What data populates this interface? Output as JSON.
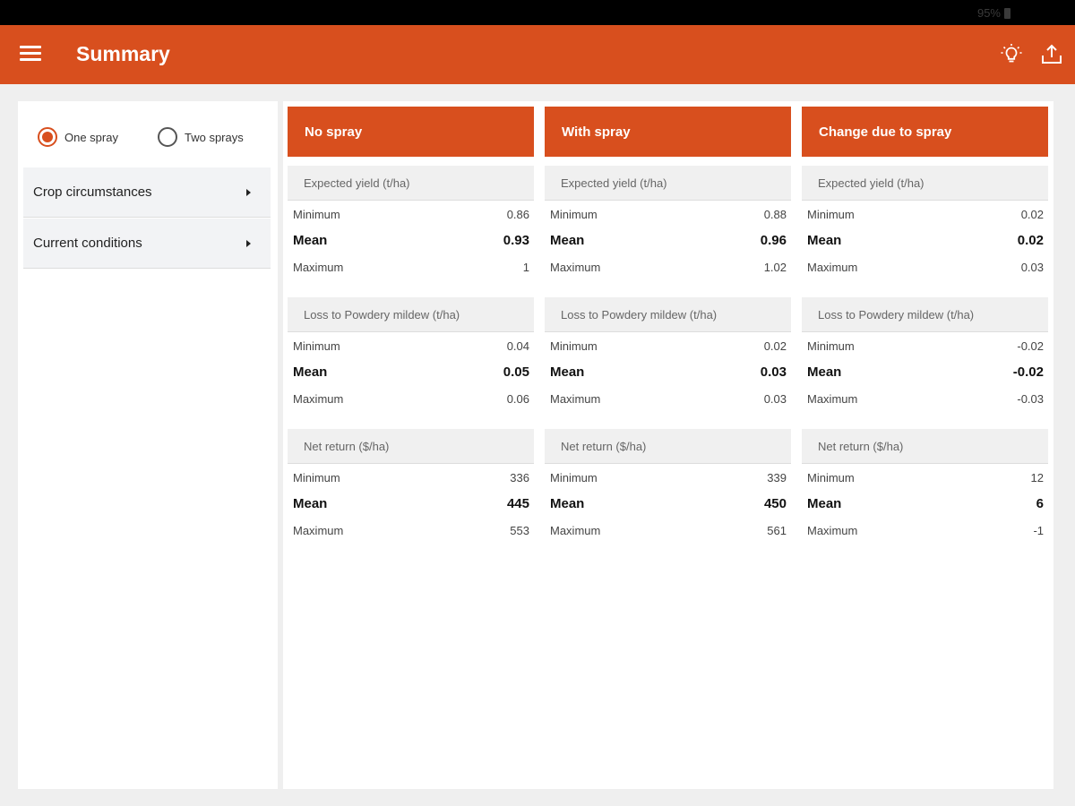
{
  "status_bar": {
    "battery": "95%"
  },
  "app_bar": {
    "title": "Summary",
    "menu_icon": "hamburger-menu-icon",
    "actions": [
      {
        "icon": "lightbulb-icon"
      },
      {
        "icon": "share-upload-icon"
      }
    ],
    "colors": {
      "accent": "#d84f1e"
    }
  },
  "left_panel": {
    "spray_options": [
      {
        "label": "One spray",
        "selected": true
      },
      {
        "label": "Two sprays",
        "selected": false
      }
    ],
    "menu_items": [
      {
        "label": "Crop circumstances"
      },
      {
        "label": "Current conditions"
      }
    ]
  },
  "summary": {
    "row_labels": {
      "min": "Minimum",
      "mean": "Mean",
      "max": "Maximum"
    },
    "columns": [
      {
        "title": "No spray",
        "sections": [
          {
            "title": "Expected yield (t/ha)",
            "min": "0.86",
            "mean": "0.93",
            "max": "1"
          },
          {
            "title": "Loss to Powdery mildew (t/ha)",
            "min": "0.04",
            "mean": "0.05",
            "max": "0.06"
          },
          {
            "title": "Net return ($/ha)",
            "min": "336",
            "mean": "445",
            "max": "553"
          }
        ]
      },
      {
        "title": "With spray",
        "sections": [
          {
            "title": "Expected yield (t/ha)",
            "min": "0.88",
            "mean": "0.96",
            "max": "1.02"
          },
          {
            "title": "Loss to Powdery mildew (t/ha)",
            "min": "0.02",
            "mean": "0.03",
            "max": "0.03"
          },
          {
            "title": "Net return ($/ha)",
            "min": "339",
            "mean": "450",
            "max": "561"
          }
        ]
      },
      {
        "title": "Change due to spray",
        "sections": [
          {
            "title": "Expected yield (t/ha)",
            "min": "0.02",
            "mean": "0.02",
            "max": "0.03"
          },
          {
            "title": "Loss to Powdery mildew (t/ha)",
            "min": "-0.02",
            "mean": "-0.02",
            "max": "-0.03"
          },
          {
            "title": "Net return ($/ha)",
            "min": "12",
            "mean": "6",
            "max": "-1"
          }
        ]
      }
    ]
  }
}
